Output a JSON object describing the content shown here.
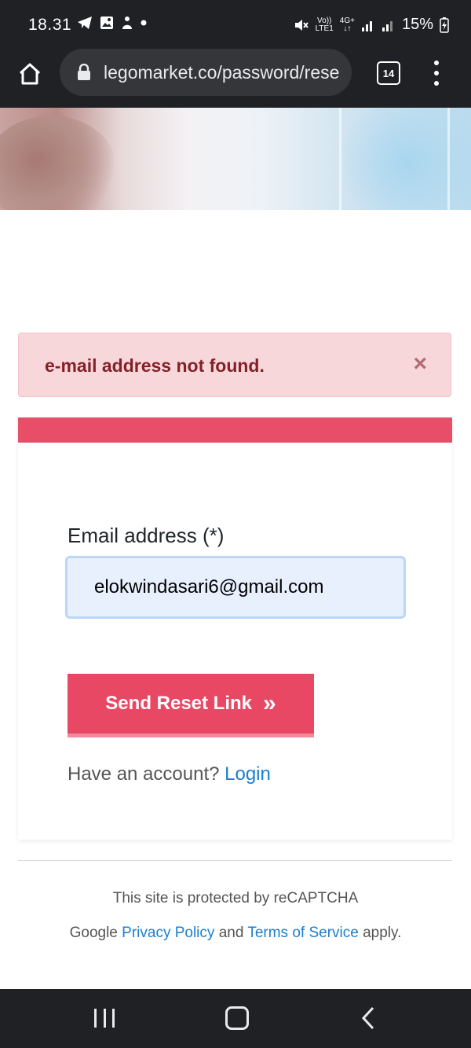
{
  "status_bar": {
    "time": "18.31",
    "volte": "Vo))",
    "lte": "LTE1",
    "network": "4G+",
    "battery": "15%"
  },
  "browser": {
    "url": "legomarket.co/password/rese",
    "tab_count": "14"
  },
  "alert": {
    "message": "e-mail address not found.",
    "close_symbol": "×"
  },
  "form": {
    "email_label": "Email address (*)",
    "email_value": "elokwindasari6@gmail.com",
    "submit_label": "Send Reset Link",
    "submit_icon": "»",
    "account_prompt": "Have an account?",
    "login_label": "Login"
  },
  "footer": {
    "recaptcha_text": "This site is protected by reCAPTCHA",
    "google_prefix": "Google",
    "privacy_label": "Privacy Policy",
    "and_text": "and",
    "terms_label": "Terms of Service",
    "apply_text": "apply."
  },
  "colors": {
    "accent": "#e94864",
    "alert_bg": "#f8d7da",
    "alert_text": "#842029",
    "link": "#1a7fd0"
  }
}
